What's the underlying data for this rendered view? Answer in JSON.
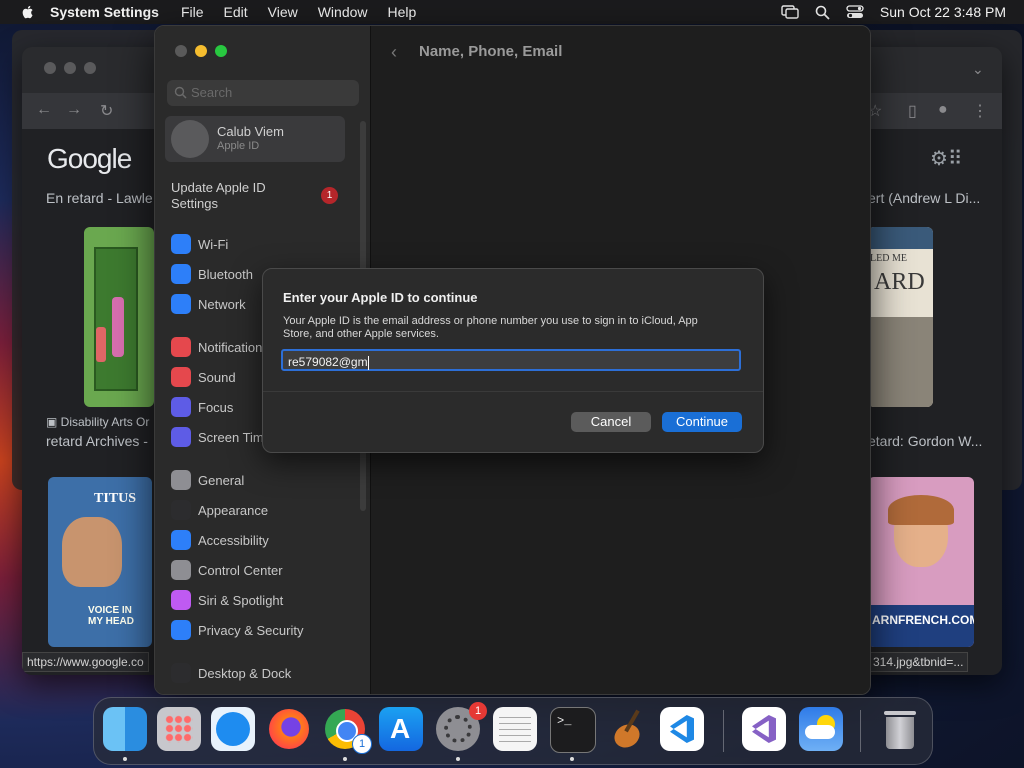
{
  "menubar": {
    "app_name": "System Settings",
    "menus": [
      "File",
      "Edit",
      "View",
      "Window",
      "Help"
    ],
    "clock": "Sun Oct 22  3:48 PM"
  },
  "browser": {
    "logo": "Google",
    "results": [
      "En retard - Lawle",
      "ert (Andrew L Di...",
      "Disability Arts Or",
      "retard Archives -",
      "etard: Gordon W...",
      "TITUS",
      "LED ME",
      "ARD",
      "ARNFRENCH.COM",
      "VOICE IN MY HEAD"
    ],
    "status_url": "https://www.google.co",
    "status_url_right": "314.jpg&tbnid=..."
  },
  "settings": {
    "search_placeholder": "Search",
    "account_name": "Calub Viem",
    "account_sub": "Apple ID",
    "update_label": "Update Apple ID Settings",
    "update_badge": "1",
    "items": [
      {
        "label": "Wi-Fi",
        "icon": "wifi-icon",
        "color": "#2d7ff9"
      },
      {
        "label": "Bluetooth",
        "icon": "bluetooth-icon",
        "color": "#2d7ff9"
      },
      {
        "label": "Network",
        "icon": "globe-icon",
        "color": "#2d7ff9"
      },
      {
        "label": "Notifications",
        "icon": "bell-icon",
        "color": "#e5484d"
      },
      {
        "label": "Sound",
        "icon": "speaker-icon",
        "color": "#e5484d"
      },
      {
        "label": "Focus",
        "icon": "moon-icon",
        "color": "#5e5ce6"
      },
      {
        "label": "Screen Time",
        "icon": "hourglass-icon",
        "color": "#5e5ce6"
      },
      {
        "label": "General",
        "icon": "gear-icon",
        "color": "#8e8e93"
      },
      {
        "label": "Appearance",
        "icon": "appearance-icon",
        "color": "#2c2c2e"
      },
      {
        "label": "Accessibility",
        "icon": "accessibility-icon",
        "color": "#2d7ff9"
      },
      {
        "label": "Control Center",
        "icon": "control-center-icon",
        "color": "#8e8e93"
      },
      {
        "label": "Siri & Spotlight",
        "icon": "siri-icon",
        "color": "#bf5af2"
      },
      {
        "label": "Privacy & Security",
        "icon": "hand-icon",
        "color": "#2d7ff9"
      },
      {
        "label": "Desktop & Dock",
        "icon": "dock-icon",
        "color": "#2c2c2e"
      }
    ],
    "content_title": "Name, Phone, Email"
  },
  "dialog": {
    "title": "Enter your Apple ID to continue",
    "description": "Your Apple ID is the email address or phone number you use to sign in to iCloud, App Store, and other Apple services.",
    "input_value": "re579082@gm",
    "cancel_label": "Cancel",
    "continue_label": "Continue",
    "accent": "#1a6fd6"
  },
  "dock": {
    "apps": [
      "Finder",
      "Launchpad",
      "Safari",
      "Firefox",
      "Chrome",
      "App Store",
      "System Settings",
      "TextEdit",
      "Terminal",
      "GarageBand",
      "Visual Studio Code",
      "Visual Studio",
      "Weather",
      "Trash"
    ],
    "settings_badge": "1",
    "chrome_badge": "1"
  }
}
